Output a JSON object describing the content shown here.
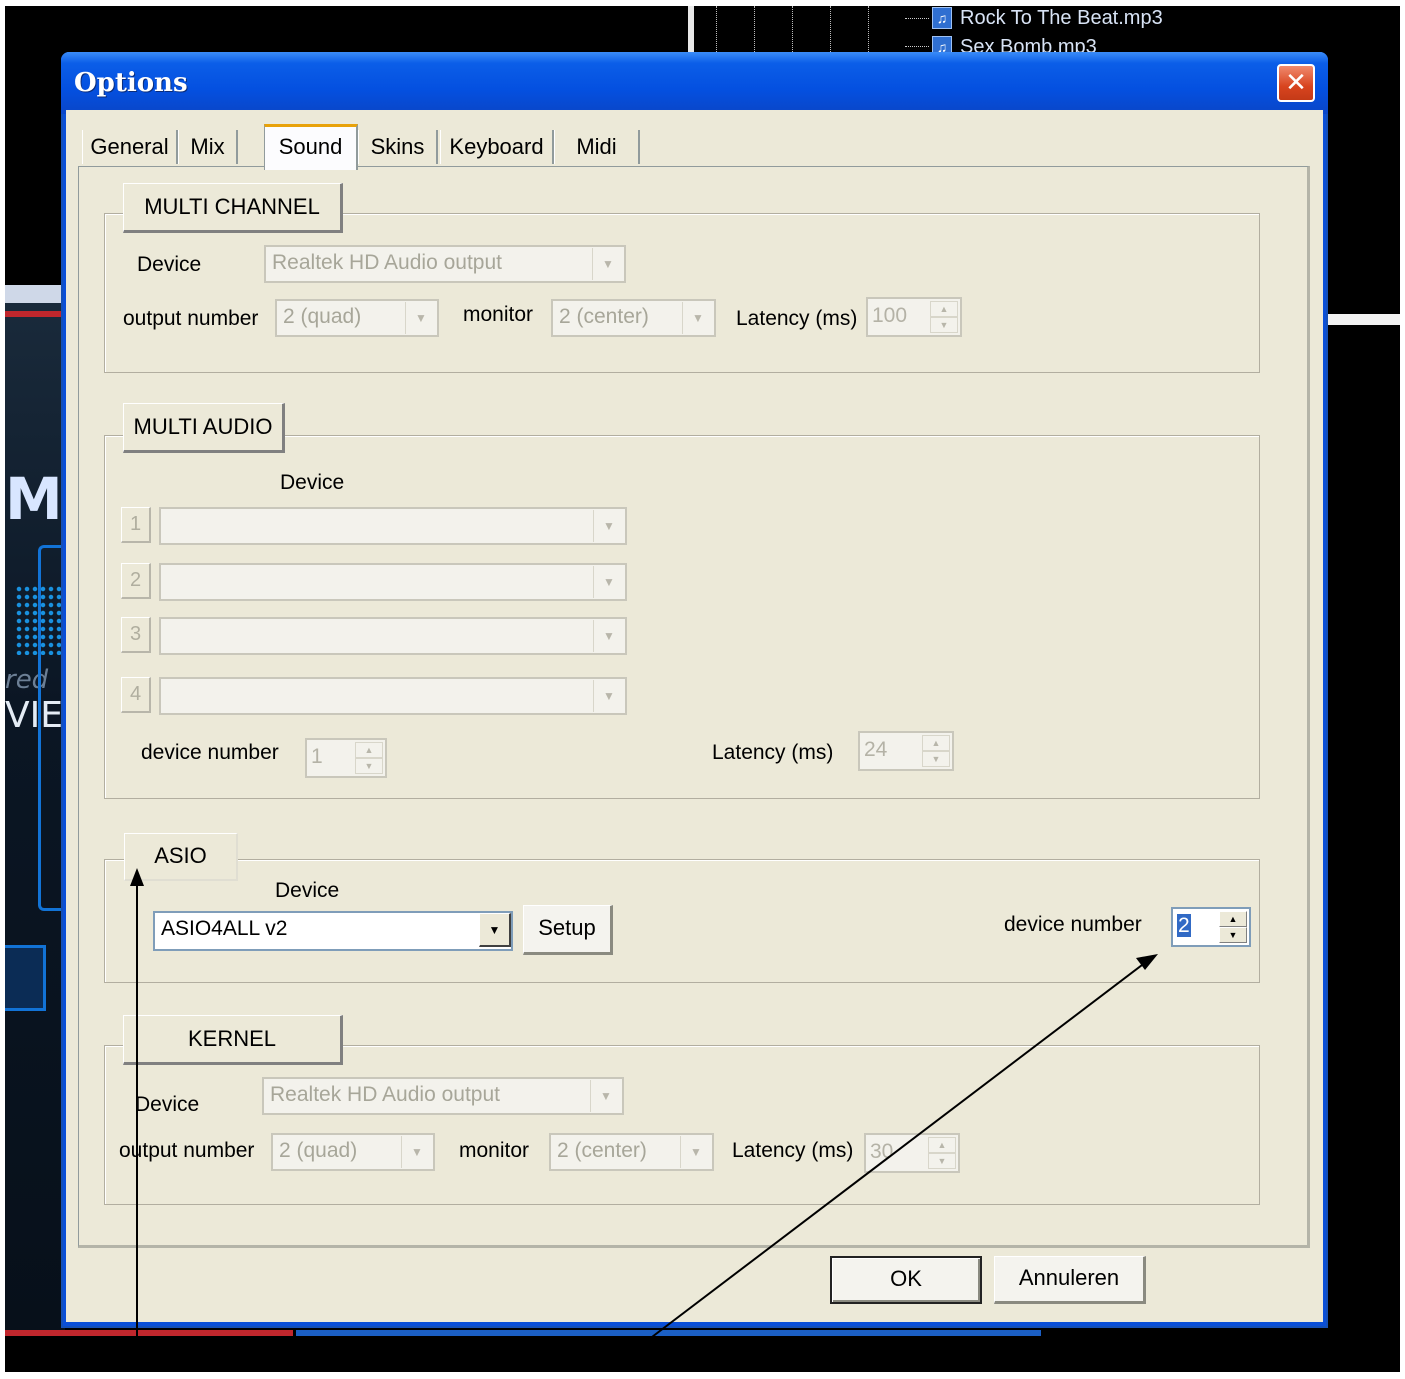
{
  "background": {
    "files": [
      {
        "name": "Rock To The Beat.mp3"
      },
      {
        "name": "Sex Bomb.mp3"
      }
    ],
    "logo_fragments": [
      "Mi",
      "red",
      "VIE"
    ]
  },
  "dialog": {
    "title": "Options",
    "close_glyph": "✕",
    "tabs": [
      {
        "label": "General",
        "active": false
      },
      {
        "label": "Mix",
        "active": false
      },
      {
        "label": "Sound",
        "active": true
      },
      {
        "label": "Skins",
        "active": false
      },
      {
        "label": "Keyboard",
        "active": false
      },
      {
        "label": "Midi",
        "active": false
      }
    ],
    "multi_channel": {
      "header": "MULTI CHANNEL",
      "device_label": "Device",
      "device_value": "Realtek HD Audio output",
      "output_label": "output number",
      "output_value": "2 (quad)",
      "monitor_label": "monitor",
      "monitor_value": "2 (center)",
      "latency_label": "Latency (ms)",
      "latency_value": "100"
    },
    "multi_audio": {
      "header": "MULTI AUDIO",
      "device_label": "Device",
      "slots": [
        "1",
        "2",
        "3",
        "4"
      ],
      "device_number_label": "device number",
      "device_number_value": "1",
      "latency_label": "Latency (ms)",
      "latency_value": "24"
    },
    "asio": {
      "header": "ASIO",
      "device_label": "Device",
      "device_value": "ASIO4ALL v2",
      "setup_label": "Setup",
      "device_number_label": "device number",
      "device_number_value": "2"
    },
    "kernel": {
      "header": "KERNEL",
      "device_label": "Device",
      "device_value": "Realtek HD Audio output",
      "output_label": "output number",
      "output_value": "2 (quad)",
      "monitor_label": "monitor",
      "monitor_value": "2 (center)",
      "latency_label": "Latency (ms)",
      "latency_value": "30"
    },
    "ok_label": "OK",
    "cancel_label": "Annuleren"
  },
  "colors": {
    "titlebar": "#0450e0",
    "dialog_face": "#ece9d8",
    "active_tab_accent": "#e8a20a",
    "close_button": "#d8441f"
  }
}
